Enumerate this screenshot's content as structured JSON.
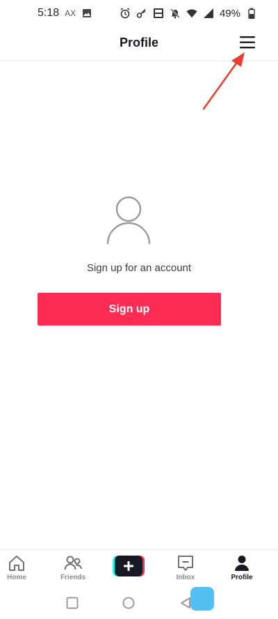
{
  "status_bar": {
    "time": "5:18",
    "carrier": "AX",
    "battery": "49%"
  },
  "header": {
    "title": "Profile",
    "menu_icon": "hamburger-menu-icon"
  },
  "empty_state": {
    "icon": "user-placeholder-icon",
    "message": "Sign up for an account",
    "signup_label": "Sign up"
  },
  "bottom_nav": {
    "items": [
      {
        "label": "Home",
        "icon": "home-icon"
      },
      {
        "label": "Friends",
        "icon": "friends-icon"
      },
      {
        "label": "",
        "icon": "plus-icon"
      },
      {
        "label": "Inbox",
        "icon": "inbox-icon"
      },
      {
        "label": "Profile",
        "icon": "profile-icon"
      }
    ],
    "active": "Profile"
  },
  "colors": {
    "accent": "#fe2c55",
    "create_left": "#25f4ee",
    "create_right": "#fe2c55",
    "annotation": "#e8402f"
  }
}
